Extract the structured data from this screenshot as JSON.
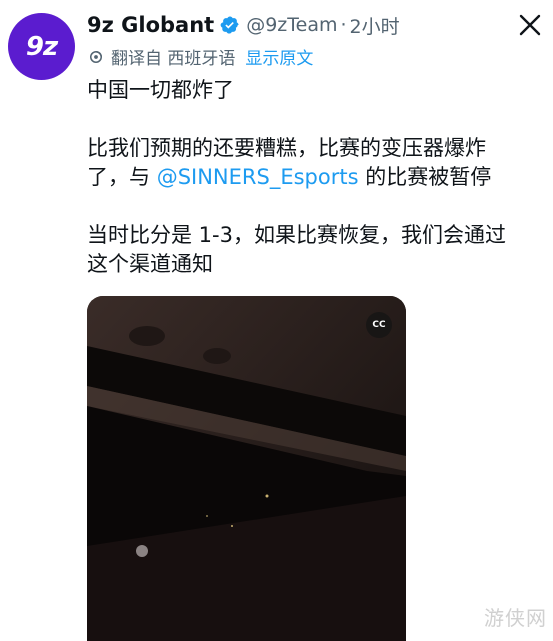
{
  "tweet": {
    "author_name": "9z Globant",
    "handle": "@9zTeam",
    "separator": "·",
    "time": "2小时",
    "avatar_text": "9z",
    "translation_prefix": "翻译自 西班牙语",
    "show_original_label": "显示原文",
    "paragraphs": {
      "p1": "中国一切都炸了",
      "p2a": "比我们预期的还要糟糕，比赛的变压器爆炸\n了，与 ",
      "p2_mention": "@SINNERS_Esports",
      "p2b": " 的比赛被暂停",
      "p3": "当时比分是 1-3，如果比赛恢复，我们会通过\n这个渠道通知"
    }
  },
  "media": {
    "cc_label": "CC",
    "watermark": "游侠网"
  },
  "colors": {
    "accent": "#1d9bf0",
    "avatar_bg": "#5b1ccf",
    "secondary_text": "#536471"
  },
  "icons": {
    "verified": "verified-badge-icon",
    "close": "close-x-icon",
    "translate": "translate-icon"
  }
}
